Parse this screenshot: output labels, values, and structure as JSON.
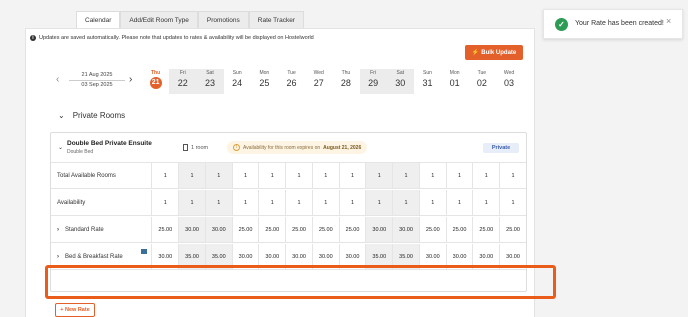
{
  "tabs": [
    {
      "label": "Calendar",
      "active": true
    },
    {
      "label": "Add/Edit Room Type",
      "active": false
    },
    {
      "label": "Promotions",
      "active": false
    },
    {
      "label": "Rate Tracker",
      "active": false
    }
  ],
  "info_text": "Updates are saved automatically. Please note that updates to rates & availability will be displayed on Hostelworld",
  "bulk_update_label": "Bulk Update",
  "date_range": {
    "from": "21 Aug 2025",
    "to": "03 Sep 2025",
    "prev_icon": "chevron-left-icon",
    "next_icon": "chevron-right-icon"
  },
  "days": [
    {
      "name": "Thu",
      "num": "21",
      "today": true,
      "weekend": false
    },
    {
      "name": "Fri",
      "num": "22",
      "today": false,
      "weekend": true
    },
    {
      "name": "Sat",
      "num": "23",
      "today": false,
      "weekend": true
    },
    {
      "name": "Sun",
      "num": "24",
      "today": false,
      "weekend": false
    },
    {
      "name": "Mon",
      "num": "25",
      "today": false,
      "weekend": false
    },
    {
      "name": "Tue",
      "num": "26",
      "today": false,
      "weekend": false
    },
    {
      "name": "Wed",
      "num": "27",
      "today": false,
      "weekend": false
    },
    {
      "name": "Thu",
      "num": "28",
      "today": false,
      "weekend": false
    },
    {
      "name": "Fri",
      "num": "29",
      "today": false,
      "weekend": true
    },
    {
      "name": "Sat",
      "num": "30",
      "today": false,
      "weekend": true
    },
    {
      "name": "Sun",
      "num": "31",
      "today": false,
      "weekend": false
    },
    {
      "name": "Mon",
      "num": "01",
      "today": false,
      "weekend": false
    },
    {
      "name": "Tue",
      "num": "02",
      "today": false,
      "weekend": false
    },
    {
      "name": "Wed",
      "num": "03",
      "today": false,
      "weekend": false
    }
  ],
  "section_title": "Private Rooms",
  "room": {
    "name": "Double Bed Private Ensuite",
    "sub": "Double Bed",
    "rooms_count": "1 room",
    "availability_notice": "Availability for this room expires on",
    "availability_date": "August 21, 2026",
    "badge": "Private"
  },
  "rows": [
    {
      "label": "Total Available Rooms",
      "expandable": false,
      "values": [
        "1",
        "1",
        "1",
        "1",
        "1",
        "1",
        "1",
        "1",
        "1",
        "1",
        "1",
        "1",
        "1",
        "1"
      ]
    },
    {
      "label": "Availability",
      "expandable": false,
      "values": [
        "1",
        "1",
        "1",
        "1",
        "1",
        "1",
        "1",
        "1",
        "1",
        "1",
        "1",
        "1",
        "1",
        "1"
      ]
    },
    {
      "label": "Standard Rate",
      "expandable": true,
      "values": [
        "25.00",
        "30.00",
        "30.00",
        "25.00",
        "25.00",
        "25.00",
        "25.00",
        "25.00",
        "30.00",
        "30.00",
        "25.00",
        "25.00",
        "25.00",
        "25.00"
      ]
    },
    {
      "label": "Bed & Breakfast Rate",
      "expandable": true,
      "values": [
        "30.00",
        "35.00",
        "35.00",
        "30.00",
        "30.00",
        "30.00",
        "30.00",
        "30.00",
        "35.00",
        "35.00",
        "30.00",
        "30.00",
        "30.00",
        "30.00"
      ]
    }
  ],
  "new_rate_label": "+ New Rate",
  "toast": {
    "message": "Your Rate has been created!",
    "status_color": "#2e9b55"
  },
  "colors": {
    "accent": "#e3602a",
    "highlight": "#e95c1a"
  }
}
